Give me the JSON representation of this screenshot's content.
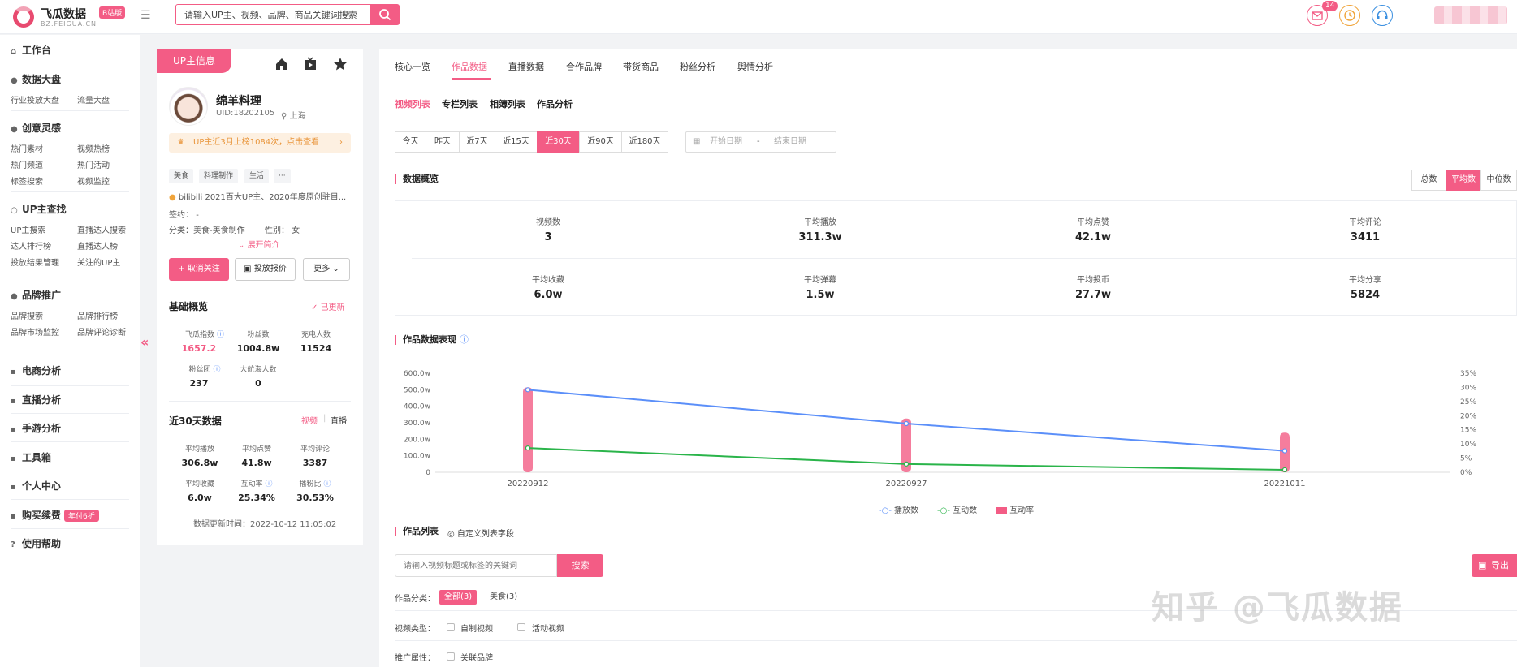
{
  "brand": {
    "name": "飞瓜数据",
    "badge": "B站版",
    "domain": "BZ.FEIGUA.CN"
  },
  "header": {
    "search_placeholder": "请输入UP主、视频、品牌、商品关键词搜索",
    "mail_count": "14"
  },
  "sidebar": {
    "workbench": "工作台",
    "groups": [
      {
        "title": "数据大盘",
        "items": [
          "行业投放大盘",
          "流量大盘"
        ]
      },
      {
        "title": "创意灵感",
        "items": [
          "热门素材",
          "视频热榜",
          "热门频道",
          "热门活动",
          "标签搜索",
          "视频监控"
        ]
      },
      {
        "title": "UP主查找",
        "items": [
          "UP主搜索",
          "直播达人搜索",
          "达人排行榜",
          "直播达人榜",
          "投放结果管理",
          "关注的UP主"
        ]
      },
      {
        "title": "品牌推广",
        "items": [
          "品牌搜索",
          "品牌排行榜",
          "品牌市场监控",
          "品牌评论诊断"
        ]
      }
    ],
    "ecommerce": "电商分析",
    "live": "直播分析",
    "game": "手游分析",
    "toolbox": "工具箱",
    "personal": "个人中心",
    "renew": "购买续费",
    "renew_promo": "年付6折",
    "help": "使用帮助"
  },
  "up": {
    "tab_label": "UP主信息",
    "name": "绵羊料理",
    "uid": "UID:18202105",
    "location": "上海",
    "notice": "UP主近3月上榜1084次，点击查看",
    "tags": [
      "美食",
      "料理制作",
      "生活",
      "···"
    ],
    "bio": "bilibili 2021百大UP主、2020年度原创驻目...",
    "sign_label": "签约：",
    "sign_value": "-",
    "category_label": "分类：",
    "category_value": "美食-美食制作",
    "gender_label": "性别：",
    "gender_value": "女",
    "expand": "展开简介",
    "unfollow": "取消关注",
    "quote": "投放报价",
    "more": "更多"
  },
  "basic": {
    "title": "基础概览",
    "updated": "已更新",
    "stats": [
      {
        "label": "飞瓜指数",
        "value": "1657.2"
      },
      {
        "label": "粉丝数",
        "value": "1004.8w"
      },
      {
        "label": "充电人数",
        "value": "11524"
      },
      {
        "label": "粉丝团",
        "value": "237"
      },
      {
        "label": "大航海人数",
        "value": "0"
      }
    ]
  },
  "recent": {
    "title": "近30天数据",
    "tab_video": "视频",
    "tab_live": "直播",
    "stats": [
      {
        "label": "平均播放",
        "value": "306.8w"
      },
      {
        "label": "平均点赞",
        "value": "41.8w"
      },
      {
        "label": "平均评论",
        "value": "3387"
      },
      {
        "label": "平均收藏",
        "value": "6.0w"
      },
      {
        "label": "互动率",
        "value": "25.34%"
      },
      {
        "label": "播粉比",
        "value": "30.53%"
      }
    ],
    "update_label": "数据更新时间：",
    "update_time": "2022-10-12 11:05:02"
  },
  "main_tabs": [
    "核心一览",
    "作品数据",
    "直播数据",
    "合作品牌",
    "带货商品",
    "粉丝分析",
    "舆情分析"
  ],
  "sub_tabs": [
    "视频列表",
    "专栏列表",
    "相簿列表",
    "作品分析"
  ],
  "date_buttons": [
    "今天",
    "昨天",
    "近7天",
    "近15天",
    "近30天",
    "近90天",
    "近180天"
  ],
  "date_range": {
    "start": "开始日期",
    "sep": "-",
    "end": "结束日期"
  },
  "overview": {
    "title": "数据概览",
    "toggles": [
      "总数",
      "平均数",
      "中位数"
    ],
    "metrics": [
      {
        "label": "视频数",
        "value": "3"
      },
      {
        "label": "平均播放",
        "value": "311.3w"
      },
      {
        "label": "平均点赞",
        "value": "42.1w"
      },
      {
        "label": "平均评论",
        "value": "3411"
      },
      {
        "label": "平均收藏",
        "value": "6.0w"
      },
      {
        "label": "平均弹幕",
        "value": "1.5w"
      },
      {
        "label": "平均投币",
        "value": "27.7w"
      },
      {
        "label": "平均分享",
        "value": "5824"
      }
    ]
  },
  "performance": {
    "title": "作品数据表现"
  },
  "chart_data": {
    "type": "line",
    "categories": [
      "20220912",
      "20220927",
      "20221011"
    ],
    "series": [
      {
        "name": "播放数",
        "values": [
          500,
          295,
          130
        ],
        "color": "#5b8ff9",
        "axis": "left"
      },
      {
        "name": "互动数",
        "values": [
          147,
          50,
          15
        ],
        "color": "#2ab44a",
        "axis": "left"
      },
      {
        "name": "互动率",
        "values": [
          30,
          19,
          14
        ],
        "color": "#f35c85",
        "axis": "right",
        "kind": "bar"
      }
    ],
    "y_ticks": [
      "0",
      "100.0w",
      "200.0w",
      "300.0w",
      "400.0w",
      "500.0w",
      "600.0w"
    ],
    "ylim": [
      0,
      600
    ],
    "y2_ticks": [
      "0%",
      "5%",
      "10%",
      "15%",
      "20%",
      "25%",
      "30%",
      "35%"
    ],
    "y2lim": [
      0,
      35
    ],
    "legend_position": "bottom"
  },
  "works": {
    "title": "作品列表",
    "custom": "自定义列表字段",
    "search_placeholder": "请输入视频标题或标签的关键词",
    "search_btn": "搜索",
    "export": "导出",
    "category_label": "作品分类：",
    "categories": [
      "全部(3)",
      "美食(3)"
    ],
    "type_label": "视频类型：",
    "types": [
      "自制视频",
      "活动视频"
    ],
    "promo_label": "推广属性：",
    "promos": [
      "关联品牌"
    ]
  },
  "watermark": "知乎 @飞瓜数据"
}
